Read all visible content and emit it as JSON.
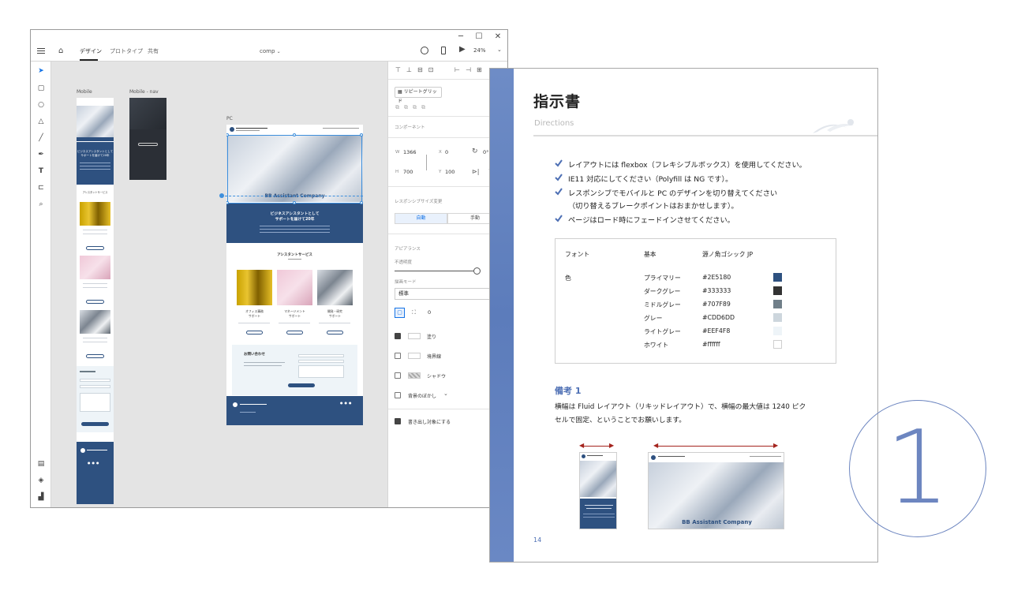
{
  "xd": {
    "menubar": {
      "tabs": [
        {
          "label": "デザイン",
          "active": true
        },
        {
          "label": "プロトタイプ",
          "active": false
        },
        {
          "label": "共有",
          "active": false
        }
      ],
      "document_name": "comp",
      "zoom": "24%"
    },
    "window_controls": {
      "minimize": "─",
      "maximize": "☐",
      "close": "✕"
    },
    "artboards": {
      "mobile_label": "Mobile",
      "mobile_nav_label": "Mobile - nav",
      "pc_label": "PC"
    },
    "site": {
      "hero_brand": "BB Assistant Company",
      "banner_line1": "ビジネスアシスタントとして",
      "banner_line2": "サポートを届けて20年",
      "services_title": "アシスタントサービス",
      "service1_line1": "オフィス事務",
      "service1_line2": "サポート",
      "service2_line1": "マネージメント",
      "service2_line2": "サポート",
      "service3_line1": "開発・研究",
      "service3_line2": "サポート",
      "contact_title": "お問い合わせ"
    },
    "props": {
      "repeat_grid": "リピートグリッド",
      "component": "コンポーネント",
      "w_label": "W",
      "w_value": "1366",
      "x_label": "X",
      "x_value": "0",
      "rot_value": "0°",
      "h_label": "H",
      "h_value": "700",
      "y_label": "Y",
      "y_value": "100",
      "responsive": "レスポンシブサイズ変更",
      "auto": "自動",
      "manual": "手動",
      "appearance": "アピアランス",
      "opacity": "不透明度",
      "blend_mode": "描画モード",
      "blend_value": "標準",
      "radius_value": "0",
      "fill": "塗り",
      "border": "境界線",
      "shadow": "シャドウ",
      "bg_blur": "背景のぼかし",
      "export_target": "書き出し対象にする"
    }
  },
  "doc": {
    "title": "指示書",
    "subtitle": "Directions",
    "bullets": [
      "レイアウトには flexbox（フレキシブルボックス）を使用してください。",
      "IE11 対応にしてください（Polyfill は NG です）。",
      "レスポンシブでモバイルと PC のデザインを切り替えてください",
      "ページはロード時にフェードインさせてください。"
    ],
    "bullet3_cont": "（切り替えるブレークポイントはおまかせします）。",
    "spec": {
      "font_label": "フォント",
      "font_basic": "基本",
      "font_name": "源ノ角ゴシック JP",
      "color_label": "色",
      "colors": [
        {
          "name": "プライマリー",
          "hex": "#2E5180",
          "swatch": "#2e5180"
        },
        {
          "name": "ダークグレー",
          "hex": "#333333",
          "swatch": "#333333"
        },
        {
          "name": "ミドルグレー",
          "hex": "#707F89",
          "swatch": "#707f89"
        },
        {
          "name": "グレー",
          "hex": "#CDD6DD",
          "swatch": "#cdd6dd"
        },
        {
          "name": "ライトグレー",
          "hex": "#EEF4F8",
          "swatch": "#eef4f8"
        },
        {
          "name": "ホワイト",
          "hex": "#ffffff",
          "swatch": "#ffffff"
        }
      ]
    },
    "note_title": "備考 1",
    "note_line1": "横幅は Fluid レイアウト（リキッドレイアウト）で、横幅の最大値は 1240 ピク",
    "note_line2": "セルで固定、ということでお願いします。",
    "preview_brand": "BB Assistant Company",
    "page_number": "14",
    "colors": {
      "accent": "#4d6fb4",
      "arrow": "#a4241e",
      "stripe": "#5c7cbb"
    }
  },
  "badge": {
    "number": "1"
  }
}
